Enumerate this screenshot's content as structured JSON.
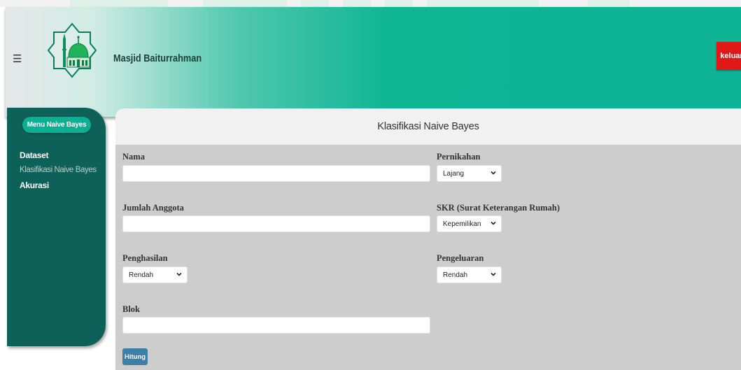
{
  "header": {
    "title": "Masjid Baiturrahman",
    "logout_label": "keluar",
    "menu_icon": "hamburger-icon",
    "logo_icon": "mosque-logo-icon"
  },
  "sidebar": {
    "title": "Menu Naive Bayes",
    "items": [
      {
        "label": "Dataset"
      },
      {
        "label": "Klasifikasi Naive Bayes"
      },
      {
        "label": "Akurasi"
      }
    ]
  },
  "main": {
    "title": "Klasifikasi Naive Bayes",
    "fields": {
      "nama": {
        "label": "Nama",
        "value": ""
      },
      "jumlah_anggota": {
        "label": "Jumlah Anggota",
        "value": ""
      },
      "penghasilan": {
        "label": "Penghasilan",
        "selected": "Rendah"
      },
      "blok": {
        "label": "Blok",
        "value": ""
      },
      "pernikahan": {
        "label": "Pernikahan",
        "selected": "Lajang"
      },
      "skr": {
        "label": "SKR (Surat Keterangan Rumah)",
        "selected": "Kepemilikan"
      },
      "pengeluaran": {
        "label": "Pengeluaran",
        "selected": "Rendah"
      }
    },
    "submit_label": "Hitung"
  },
  "colors": {
    "header_accent": "#0db495",
    "sidebar_bg": "#0d6159",
    "sidebar_badge": "#0bb093",
    "logout_bg": "#e01818",
    "button_bg": "#3d7fa6",
    "panel_bg": "#cdcdcd"
  }
}
